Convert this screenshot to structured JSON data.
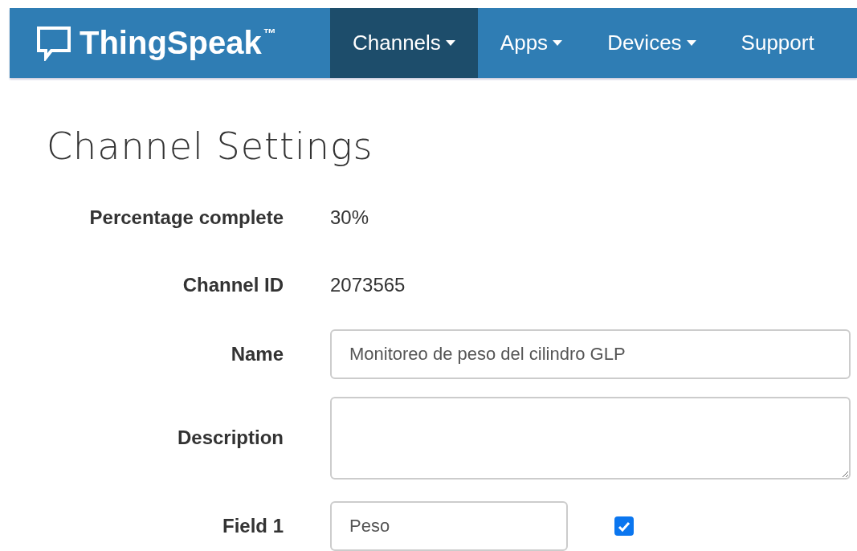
{
  "navbar": {
    "logo": "ThingSpeak",
    "trademark": "™",
    "items": [
      {
        "label": "Channels",
        "selected": true,
        "dropdown": true
      },
      {
        "label": "Apps",
        "selected": false,
        "dropdown": true
      },
      {
        "label": "Devices",
        "selected": false,
        "dropdown": true
      },
      {
        "label": "Support",
        "selected": false,
        "dropdown": false
      }
    ]
  },
  "title": "Channel Settings",
  "rows": [
    {
      "kind": "text",
      "label": "Percentage complete",
      "value": "30%"
    },
    {
      "kind": "text",
      "label": "Channel ID",
      "value": "2073565"
    },
    {
      "kind": "input",
      "label": "Name",
      "value": "Monitoreo de peso del cilindro GLP"
    },
    {
      "kind": "textarea",
      "label": "Description"
    },
    {
      "kind": "field",
      "label": "Field 1",
      "value": "Peso",
      "checked": true
    }
  ]
}
